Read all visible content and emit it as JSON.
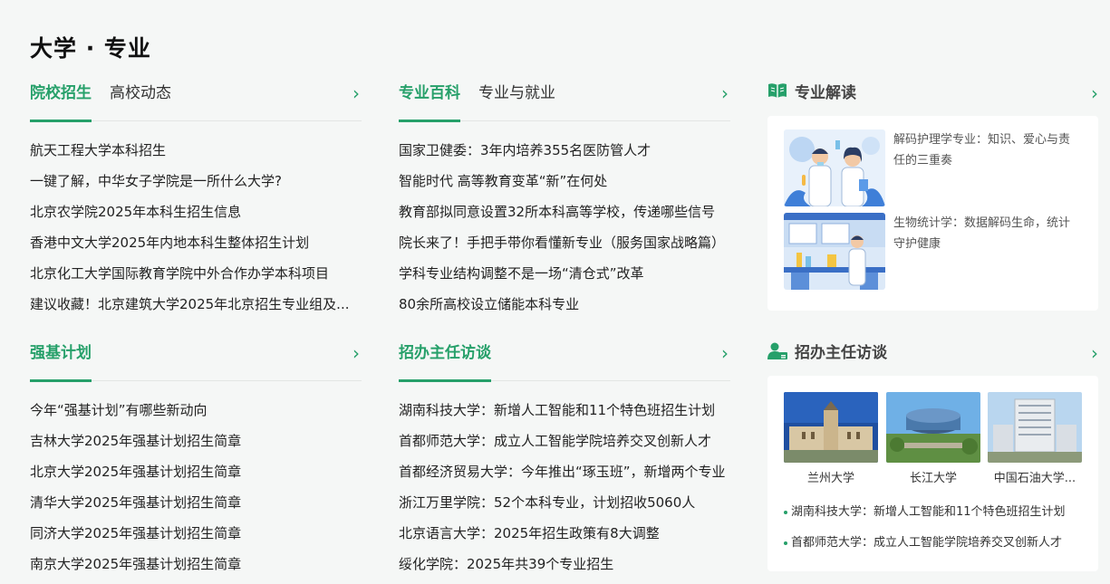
{
  "page_title": "大学 · 专业",
  "section1": {
    "tabs": [
      "院校招生",
      "高校动态"
    ],
    "more": "›",
    "items": [
      "航天工程大学本科招生",
      "一键了解，中华女子学院是一所什么大学?",
      "北京农学院2025年本科生招生信息",
      "香港中文大学2025年内地本科生整体招生计划",
      "北京化工大学国际教育学院中外合作办学本科项目",
      "建议收藏！北京建筑大学2025年北京招生专业组及..."
    ]
  },
  "section2": {
    "tabs": [
      "专业百科",
      "专业与就业"
    ],
    "more": "›",
    "items": [
      "国家卫健委：3年内培养355名医防管人才",
      "智能时代 高等教育变革“新”在何处",
      "教育部拟同意设置32所本科高等学校，传递哪些信号",
      "院长来了！手把手带你看懂新专业（服务国家战略篇）",
      "学科专业结构调整不是一场“清仓式”改革",
      "80余所高校设立储能本科专业"
    ]
  },
  "section3": {
    "tabs": [
      "强基计划"
    ],
    "more": "›",
    "items": [
      "今年“强基计划”有哪些新动向",
      "吉林大学2025年强基计划招生简章",
      "北京大学2025年强基计划招生简章",
      "清华大学2025年强基计划招生简章",
      "同济大学2025年强基计划招生简章",
      "南京大学2025年强基计划招生简章"
    ]
  },
  "section4": {
    "tabs": [
      "招办主任访谈"
    ],
    "more": "›",
    "items": [
      "湖南科技大学：新增人工智能和11个特色班招生计划",
      "首都师范大学：成立人工智能学院培养交叉创新人才",
      "首都经济贸易大学：今年推出“琢玉班”，新增两个专业",
      "浙江万里学院：52个本科专业，计划招收5060人",
      "北京语言大学：2025年招生政策有8大调整",
      "绥化学院：2025年共39个专业招生"
    ]
  },
  "side1": {
    "title": "专业解读",
    "icon": "book-icon",
    "more": "›",
    "articles": [
      {
        "text": "解码护理学专业：知识、爱心与责任的三重奏",
        "image": "doctors-illustration"
      },
      {
        "text": "生物统计学：数据解码生命，统计守护健康",
        "image": "lab-illustration"
      }
    ]
  },
  "side2": {
    "title": "招办主任访谈",
    "icon": "user-badge-icon",
    "more": "›",
    "universities": [
      "兰州大学",
      "长江大学",
      "中国石油大学..."
    ],
    "news": [
      "湖南科技大学：新增人工智能和11个特色班招生计划",
      "首都师范大学：成立人工智能学院培养交叉创新人才"
    ]
  },
  "colors": {
    "accent": "#26a06a",
    "background": "#f5f7f6",
    "card": "#ffffff"
  }
}
